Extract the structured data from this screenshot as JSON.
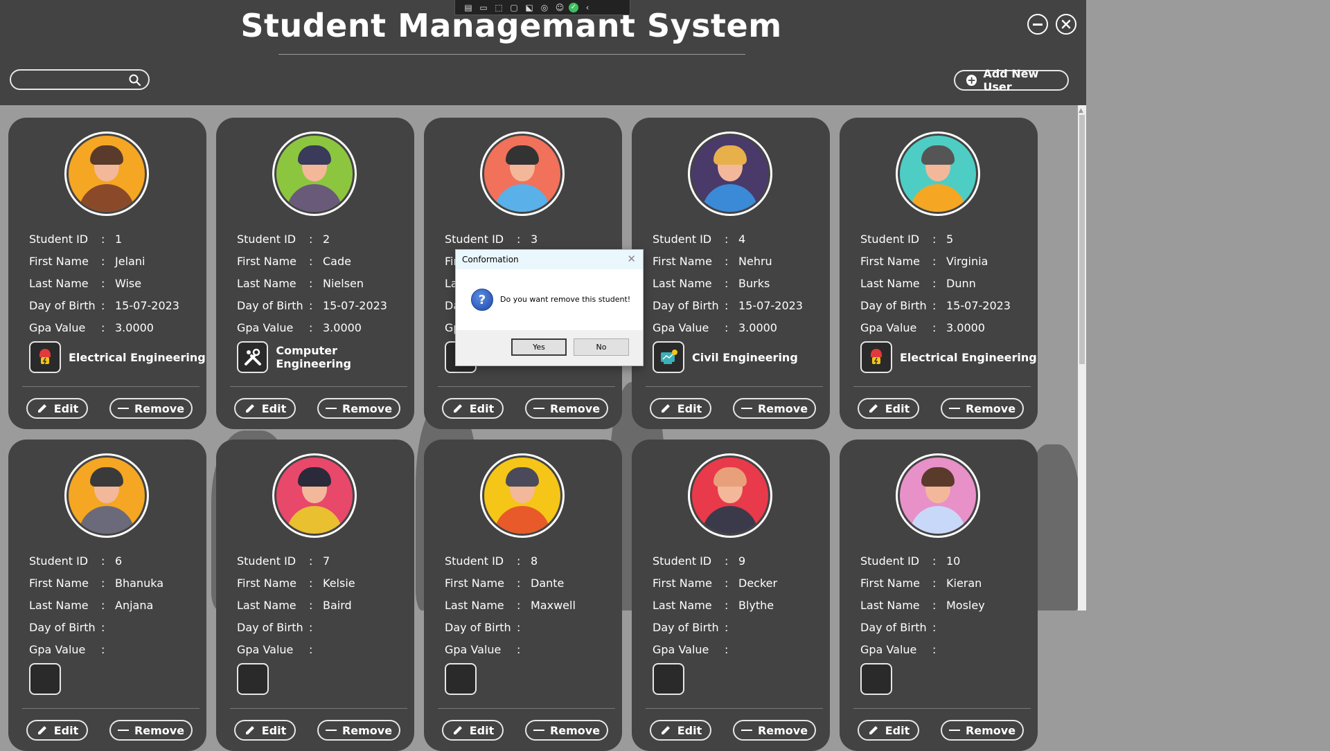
{
  "app": {
    "title": "Student Managemant System"
  },
  "toolbar": {
    "add_user_label": "Add New User"
  },
  "search": {
    "value": "",
    "placeholder": ""
  },
  "labels": {
    "student_id": "Student ID",
    "first_name": "First Name",
    "last_name": "Last Name",
    "dob": "Day of Birth",
    "gpa": "Gpa Value",
    "colon": ":",
    "edit": "Edit",
    "remove": "Remove"
  },
  "students": [
    {
      "id": "1",
      "first_name": "Jelani",
      "last_name": "Wise",
      "dob": "15-07-2023",
      "gpa": "3.0000",
      "department": "Electrical Engineering",
      "dept_icon": "electrical-icon",
      "avatar_bg": "#f5a623",
      "hair": "#5a3a2a",
      "shirt": "#8a4a2a"
    },
    {
      "id": "2",
      "first_name": "Cade",
      "last_name": "Nielsen",
      "dob": "15-07-2023",
      "gpa": "3.0000",
      "department": "Computer Engineering",
      "dept_icon": "tools-icon",
      "avatar_bg": "#8cc63f",
      "hair": "#3a3a5a",
      "shirt": "#6a5a7a"
    },
    {
      "id": "3",
      "first_name": "",
      "last_name": "",
      "dob": "",
      "gpa": "",
      "department": "",
      "dept_icon": "gear-icon",
      "avatar_bg": "#f2715a",
      "hair": "#333333",
      "shirt": "#5ab0e8"
    },
    {
      "id": "4",
      "first_name": "Nehru",
      "last_name": "Burks",
      "dob": "15-07-2023",
      "gpa": "3.0000",
      "department": "Civil Engineering",
      "dept_icon": "civil-icon",
      "avatar_bg": "#4a3a6a",
      "hair": "#e8b04a",
      "shirt": "#3a8ad8"
    },
    {
      "id": "5",
      "first_name": "Virginia",
      "last_name": "Dunn",
      "dob": "15-07-2023",
      "gpa": "3.0000",
      "department": "Electrical Engineering",
      "dept_icon": "electrical-icon",
      "avatar_bg": "#4ecdc4",
      "hair": "#555555",
      "shirt": "#f5a623"
    },
    {
      "id": "6",
      "first_name": "Bhanuka",
      "last_name": "Anjana",
      "dob": "",
      "gpa": "",
      "department": "",
      "dept_icon": "",
      "avatar_bg": "#f5a623",
      "hair": "#3a3a3a",
      "shirt": "#6a6a7a"
    },
    {
      "id": "7",
      "first_name": "Kelsie",
      "last_name": "Baird",
      "dob": "",
      "gpa": "",
      "department": "",
      "dept_icon": "",
      "avatar_bg": "#e8486a",
      "hair": "#2a2a3a",
      "shirt": "#e8c030"
    },
    {
      "id": "8",
      "first_name": "Dante",
      "last_name": "Maxwell",
      "dob": "",
      "gpa": "",
      "department": "",
      "dept_icon": "",
      "avatar_bg": "#f5c518",
      "hair": "#4a4a5a",
      "shirt": "#e85a2a"
    },
    {
      "id": "9",
      "first_name": "Decker",
      "last_name": "Blythe",
      "dob": "",
      "gpa": "",
      "department": "",
      "dept_icon": "",
      "avatar_bg": "#e83a4a",
      "hair": "#e8a07a",
      "shirt": "#3a3a4a"
    },
    {
      "id": "10",
      "first_name": "Kieran",
      "last_name": "Mosley",
      "dob": "",
      "gpa": "",
      "department": "",
      "dept_icon": "",
      "avatar_bg": "#e890c8",
      "hair": "#5a3a2a",
      "shirt": "#c8d8f8"
    }
  ],
  "dialog": {
    "title": "Conformation",
    "message": "Do you want remove this student!",
    "yes": "Yes",
    "no": "No"
  }
}
